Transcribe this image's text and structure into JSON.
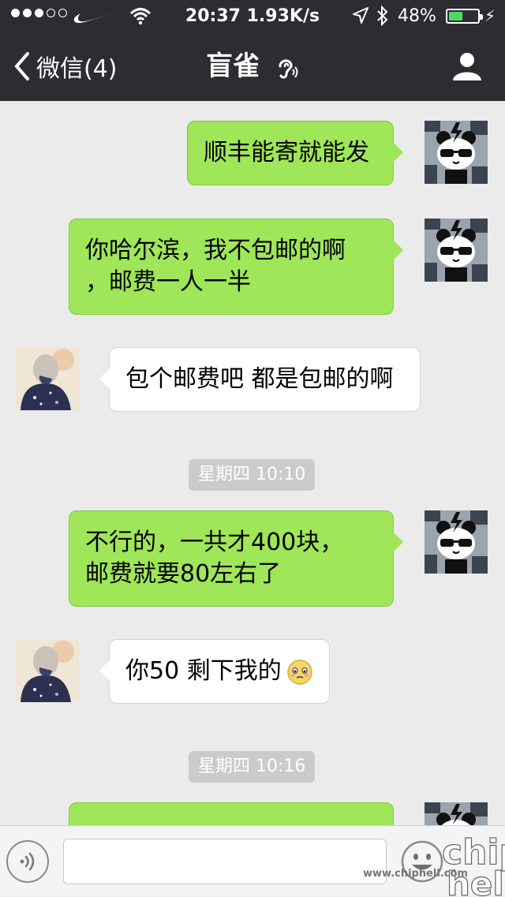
{
  "status_bar": {
    "time": "20:37",
    "network_speed": "1.93K/s",
    "battery_percent": "48%",
    "battery_level": 0.48,
    "signal_dots_filled": 3,
    "signal_dots_total": 5,
    "carrier_icon": "nike-swoosh-icon"
  },
  "nav": {
    "back_label": "微信(4)",
    "title": "盲雀",
    "title_icon": "ear-icon",
    "profile_icon": "person-icon"
  },
  "colors": {
    "nav_bg": "#2b2d31",
    "chat_bg": "#ebebeb",
    "sent_bubble": "#9fe658",
    "received_bubble": "#ffffff",
    "timestamp_bg": "#cbcbcb",
    "battery_fill": "#4cd964"
  },
  "messages": [
    {
      "side": "sent",
      "text": "顺丰能寄就能发"
    },
    {
      "side": "sent",
      "lines": [
        "你哈尔滨，我不包邮的啊",
        "，邮费一人一半"
      ]
    },
    {
      "side": "received",
      "text": "包个邮费吧 都是包邮的啊"
    },
    {
      "timestamp": "星期四 10:10"
    },
    {
      "side": "sent",
      "lines": [
        "不行的，一共才400块，",
        "邮费就要80左右了"
      ]
    },
    {
      "side": "received",
      "text": "你50 剩下我的",
      "emoji": "shy-face-emoji"
    },
    {
      "timestamp": "星期四 10:16"
    },
    {
      "side": "sent",
      "text": ""
    }
  ],
  "input_bar": {
    "voice_icon": "voice-icon",
    "text_value": "",
    "emoji_icon": "smiley-icon"
  },
  "watermark": {
    "logo": "chiphell",
    "url": "www.chiphell.com"
  }
}
